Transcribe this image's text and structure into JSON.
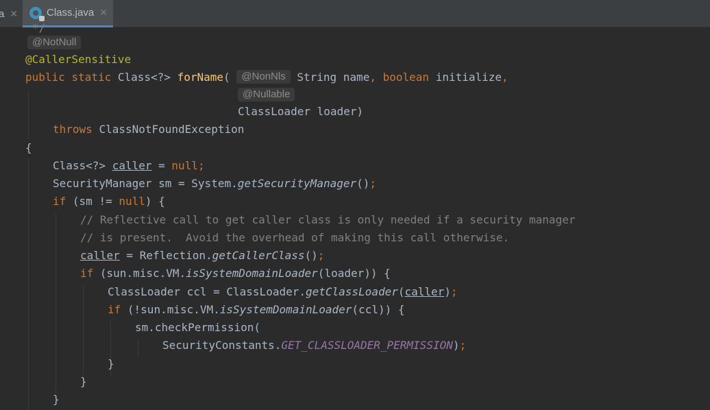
{
  "tabs": [
    {
      "label": "a",
      "active": false
    },
    {
      "label": "Class.java",
      "active": true
    }
  ],
  "inlay_hints": {
    "not_null": "@NotNull",
    "non_nls": "@NonNls",
    "nullable": "@Nullable"
  },
  "code": {
    "comment_end": "*/",
    "annotation": "@CallerSensitive",
    "l_public": "public",
    "l_static": "static",
    "l_class_ret": "Class<?>",
    "l_method": "forName",
    "l_paren": "(",
    "l_param1": "String name",
    "l_comma": ",",
    "l_boolean": "boolean",
    "l_param2": "initialize",
    "l_loader": "ClassLoader loader)",
    "l_throws": "throws",
    "l_exception": "ClassNotFoundException",
    "l_open": "{",
    "s1_type": "Class<?>",
    "s1_var": "caller",
    "s1_eq": "=",
    "s1_null": "null",
    "s1_semi": ";",
    "s2_decl": "SecurityManager sm = System.",
    "s2_call": "getSecurityManager",
    "s2_end": "()",
    "s3_if": "if",
    "s3_cond": "(sm != ",
    "s3_null": "null",
    "s3_end": ") {",
    "c1": "// Reflective call to get caller class is only needed if a security manager",
    "c2": "// is present.  Avoid the overhead of making this call otherwise.",
    "s4_var": "caller",
    "s4_mid": " = Reflection.",
    "s4_call": "getCallerClass",
    "s4_end": "()",
    "s5_if": "if",
    "s5_a": "(sun.misc.VM.",
    "s5_call": "isSystemDomainLoader",
    "s5_end": "(loader)) {",
    "s6_a": "ClassLoader ccl = ClassLoader.",
    "s6_call": "getClassLoader",
    "s6_open": "(",
    "s6_var": "caller",
    "s6_close": ")",
    "s7_if": "if",
    "s7_a": "(!sun.misc.VM.",
    "s7_call": "isSystemDomainLoader",
    "s7_end": "(ccl)) {",
    "s8": "sm.checkPermission(",
    "s9_a": "SecurityConstants.",
    "s9_const": "GET_CLASSLOADER_PERMISSION",
    "s9_close": ")",
    "close_brace": "}"
  }
}
